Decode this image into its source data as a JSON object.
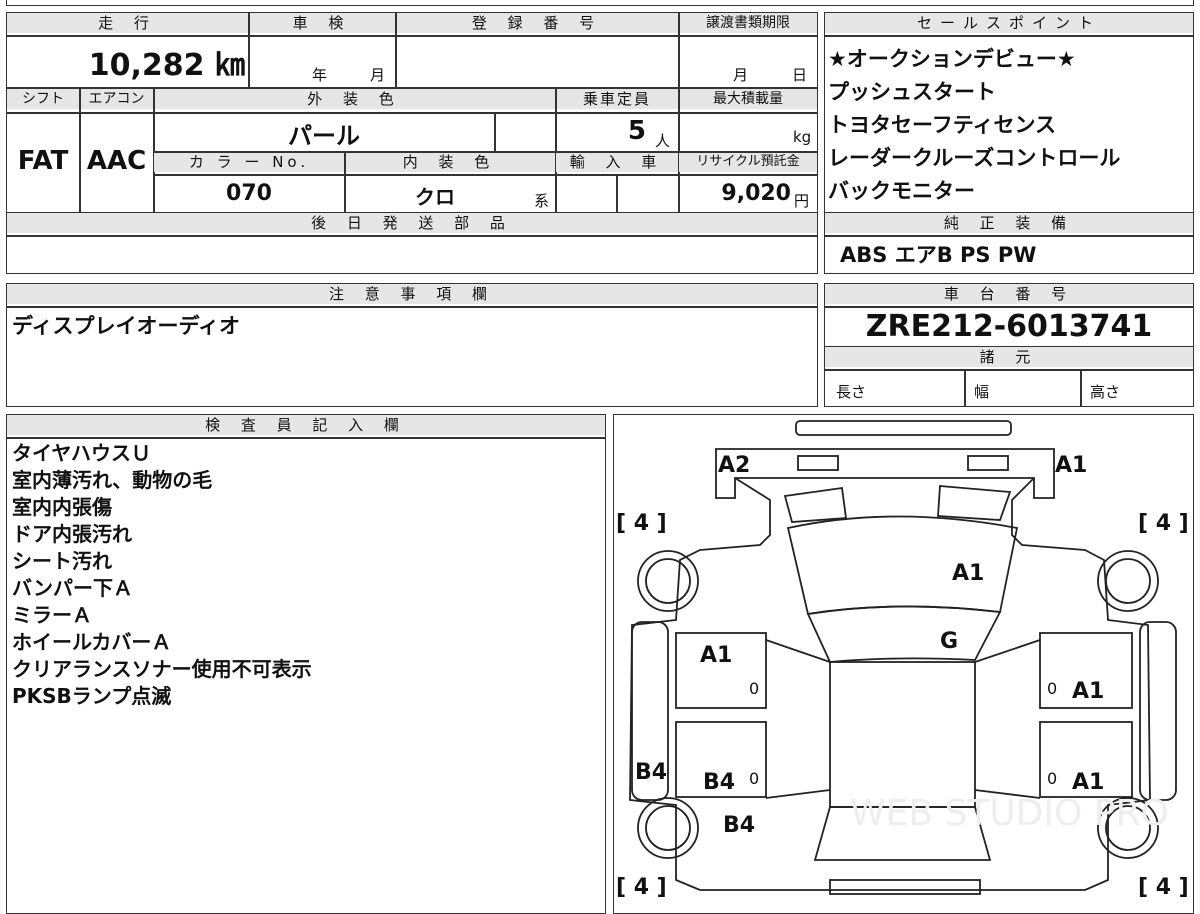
{
  "mileage": {
    "label": "走 行",
    "value": "10,282 ㎞"
  },
  "inspection": {
    "label": "車 検",
    "year_unit": "年",
    "month_unit": "月"
  },
  "registration": {
    "label": "登 録 番 号",
    "value": ""
  },
  "transfer_deadline": {
    "label": "譲渡書類期限",
    "month_unit": "月",
    "day_unit": "日"
  },
  "shift": {
    "label": "シフト",
    "value": "FAT"
  },
  "aircon": {
    "label": "エアコン",
    "value": "AAC"
  },
  "exterior_color": {
    "label": "外 装 色",
    "value": "パール"
  },
  "capacity": {
    "label": "乗車定員",
    "value": "5",
    "unit": "人"
  },
  "max_load": {
    "label": "最大積載量",
    "unit": "kg"
  },
  "color_no": {
    "label": "カ ラ ー No.",
    "value": "070"
  },
  "interior_color": {
    "label": "内 装 色",
    "value": "クロ",
    "suffix": "系"
  },
  "import": {
    "label": "輸 入 車"
  },
  "recycle": {
    "label": "リサイクル預託金",
    "value": "9,020",
    "unit": "円"
  },
  "later_parts": {
    "label": "後 日 発 送 部 品"
  },
  "sales_points": {
    "label": "セールスポイント",
    "items": [
      "★オークションデビュー★",
      "プッシュスタート",
      "トヨタセーフティセンス",
      "レーダークルーズコントロール",
      "バックモニター"
    ]
  },
  "genuine_equipment": {
    "label": "純 正 装 備",
    "value": "ABS エアB PS PW"
  },
  "notes": {
    "label": "注 意 事 項 欄",
    "text": "ディスプレイオーディオ"
  },
  "chassis": {
    "label": "車 台 番 号",
    "value": "ZRE212-6013741"
  },
  "specs": {
    "label": "諸 元",
    "length": "長さ",
    "width": "幅",
    "height": "高さ"
  },
  "inspector": {
    "label": "検 査 員 記 入 欄",
    "items": [
      "タイヤハウスＵ",
      "室内薄汚れ、動物の毛",
      "室内内張傷",
      "ドア内張汚れ",
      "シート汚れ",
      "バンパー下Ａ",
      "ミラーＡ",
      "ホイールカバーＡ",
      "クリアランスソナー使用不可表示",
      "PKSBランプ点滅"
    ]
  },
  "diagram": {
    "tire_marks": [
      "[ 4 ]",
      "[ 4 ]",
      "[ 4 ]",
      "[ 4 ]"
    ],
    "marks": {
      "front_left": "A2",
      "front_right": "A1",
      "hood": "A1",
      "windshield": "G",
      "left_front_door": "A1",
      "right_front_door": "A1",
      "left_rear_door": "B4",
      "right_rear_door": "A1",
      "left_rocker": "B4",
      "left_rear_fender": "B4"
    },
    "zeros": [
      "0",
      "0",
      "0",
      "0"
    ],
    "watermark": "WEB STUDIO PRO"
  }
}
